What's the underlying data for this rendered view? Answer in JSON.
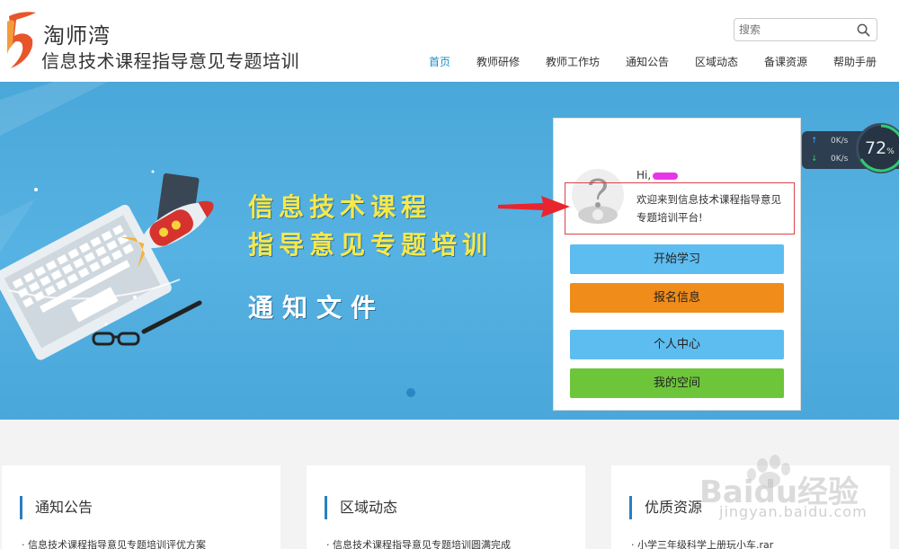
{
  "header": {
    "brand": "淘师湾",
    "subtitle": "信息技术课程指导意见专题培训",
    "search_placeholder": "搜索",
    "nav": [
      "首页",
      "教师研修",
      "教师工作坊",
      "通知公告",
      "区域动态",
      "备课资源",
      "帮助手册"
    ],
    "active_nav": "首页"
  },
  "banner": {
    "title_line1": "信息技术课程",
    "title_line2": "指导意见专题培训",
    "notice": "通知文件"
  },
  "panel": {
    "greeting": "Hi,",
    "welcome": "欢迎来到信息技术课程指导意见专题培训平台!",
    "buttons": {
      "start": "开始学习",
      "signup": "报名信息",
      "profile": "个人中心",
      "space": "我的空间"
    }
  },
  "speed": {
    "up": "0K/s",
    "down": "0K/s",
    "percent": "72",
    "percent_unit": "%"
  },
  "cards": [
    {
      "title": "通知公告",
      "item": "· 信息技术课程指导意见专题培训评优方案"
    },
    {
      "title": "区域动态",
      "item": "· 信息技术课程指导意见专题培训圆满完成"
    },
    {
      "title": "优质资源",
      "item": "· 小学三年级科学上册玩小车.rar"
    }
  ],
  "watermark": {
    "big": "Baidu经验",
    "url": "jingyan.baidu.com"
  },
  "colors": {
    "banner": "#56b2e2",
    "blue_button": "#5ebdf0",
    "orange_button": "#f08c1a",
    "green_button": "#6dc539",
    "nav_active": "#1a8fc9"
  }
}
